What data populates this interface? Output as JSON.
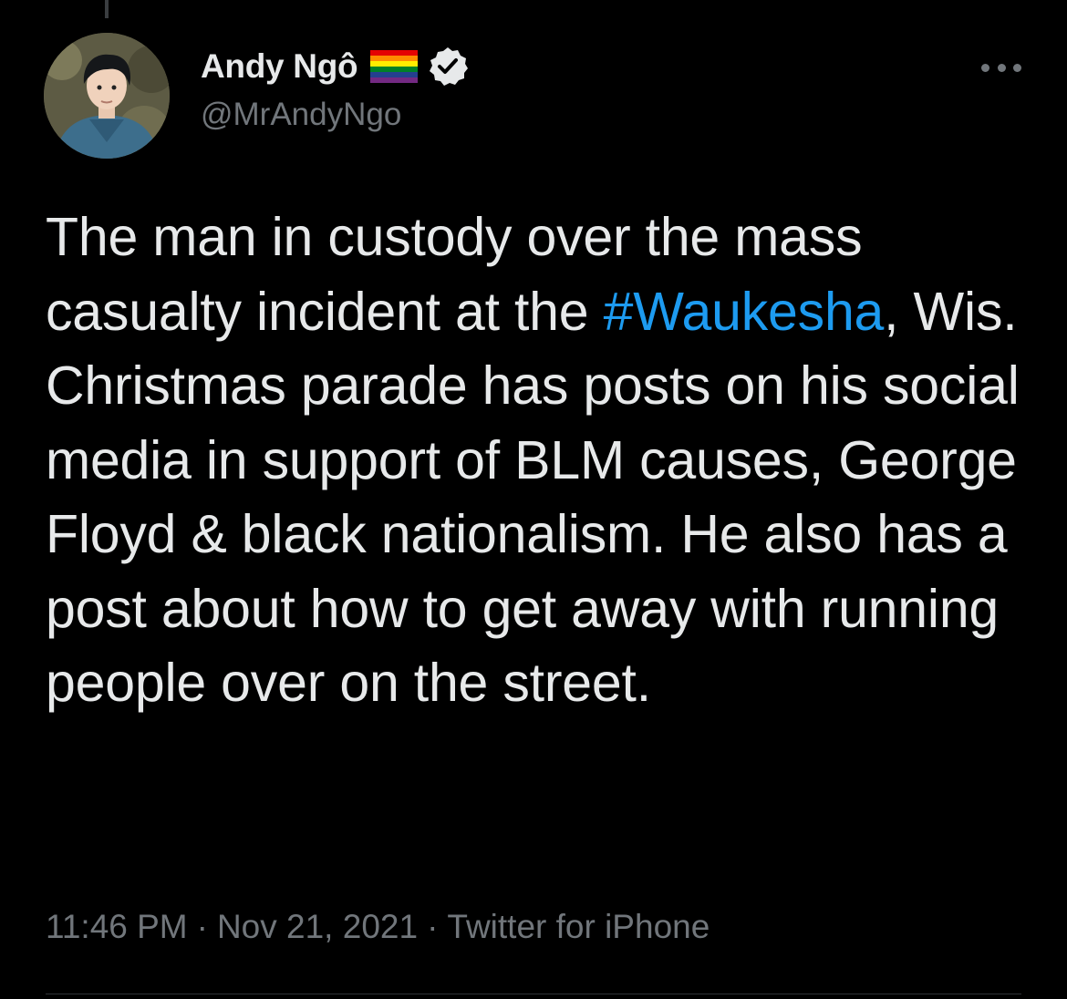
{
  "tweet": {
    "author": {
      "display_name": "Andy Ngô",
      "handle": "@MrAndyNgo",
      "flag_icon": "rainbow-flag-icon",
      "verified_icon": "verified-badge-icon"
    },
    "text": {
      "before_hashtag": "The man in custody over the mass casualty incident at the ",
      "hashtag": "#Waukesha",
      "after_hashtag": ", Wis. Christmas parade has posts on his social media in support of BLM causes, George Floyd & black nationalism. He also has a post about how to get away with running people over on the street."
    },
    "meta": {
      "time": "11:46 PM",
      "date": "Nov 21, 2021",
      "separator": "·",
      "source": "Twitter for iPhone"
    },
    "more_icon": "more-horizontal-icon"
  },
  "colors": {
    "background": "#000000",
    "text_primary": "#e7e9ea",
    "text_secondary": "#71767b",
    "link": "#1d9bf0",
    "divider": "#2f3336"
  }
}
